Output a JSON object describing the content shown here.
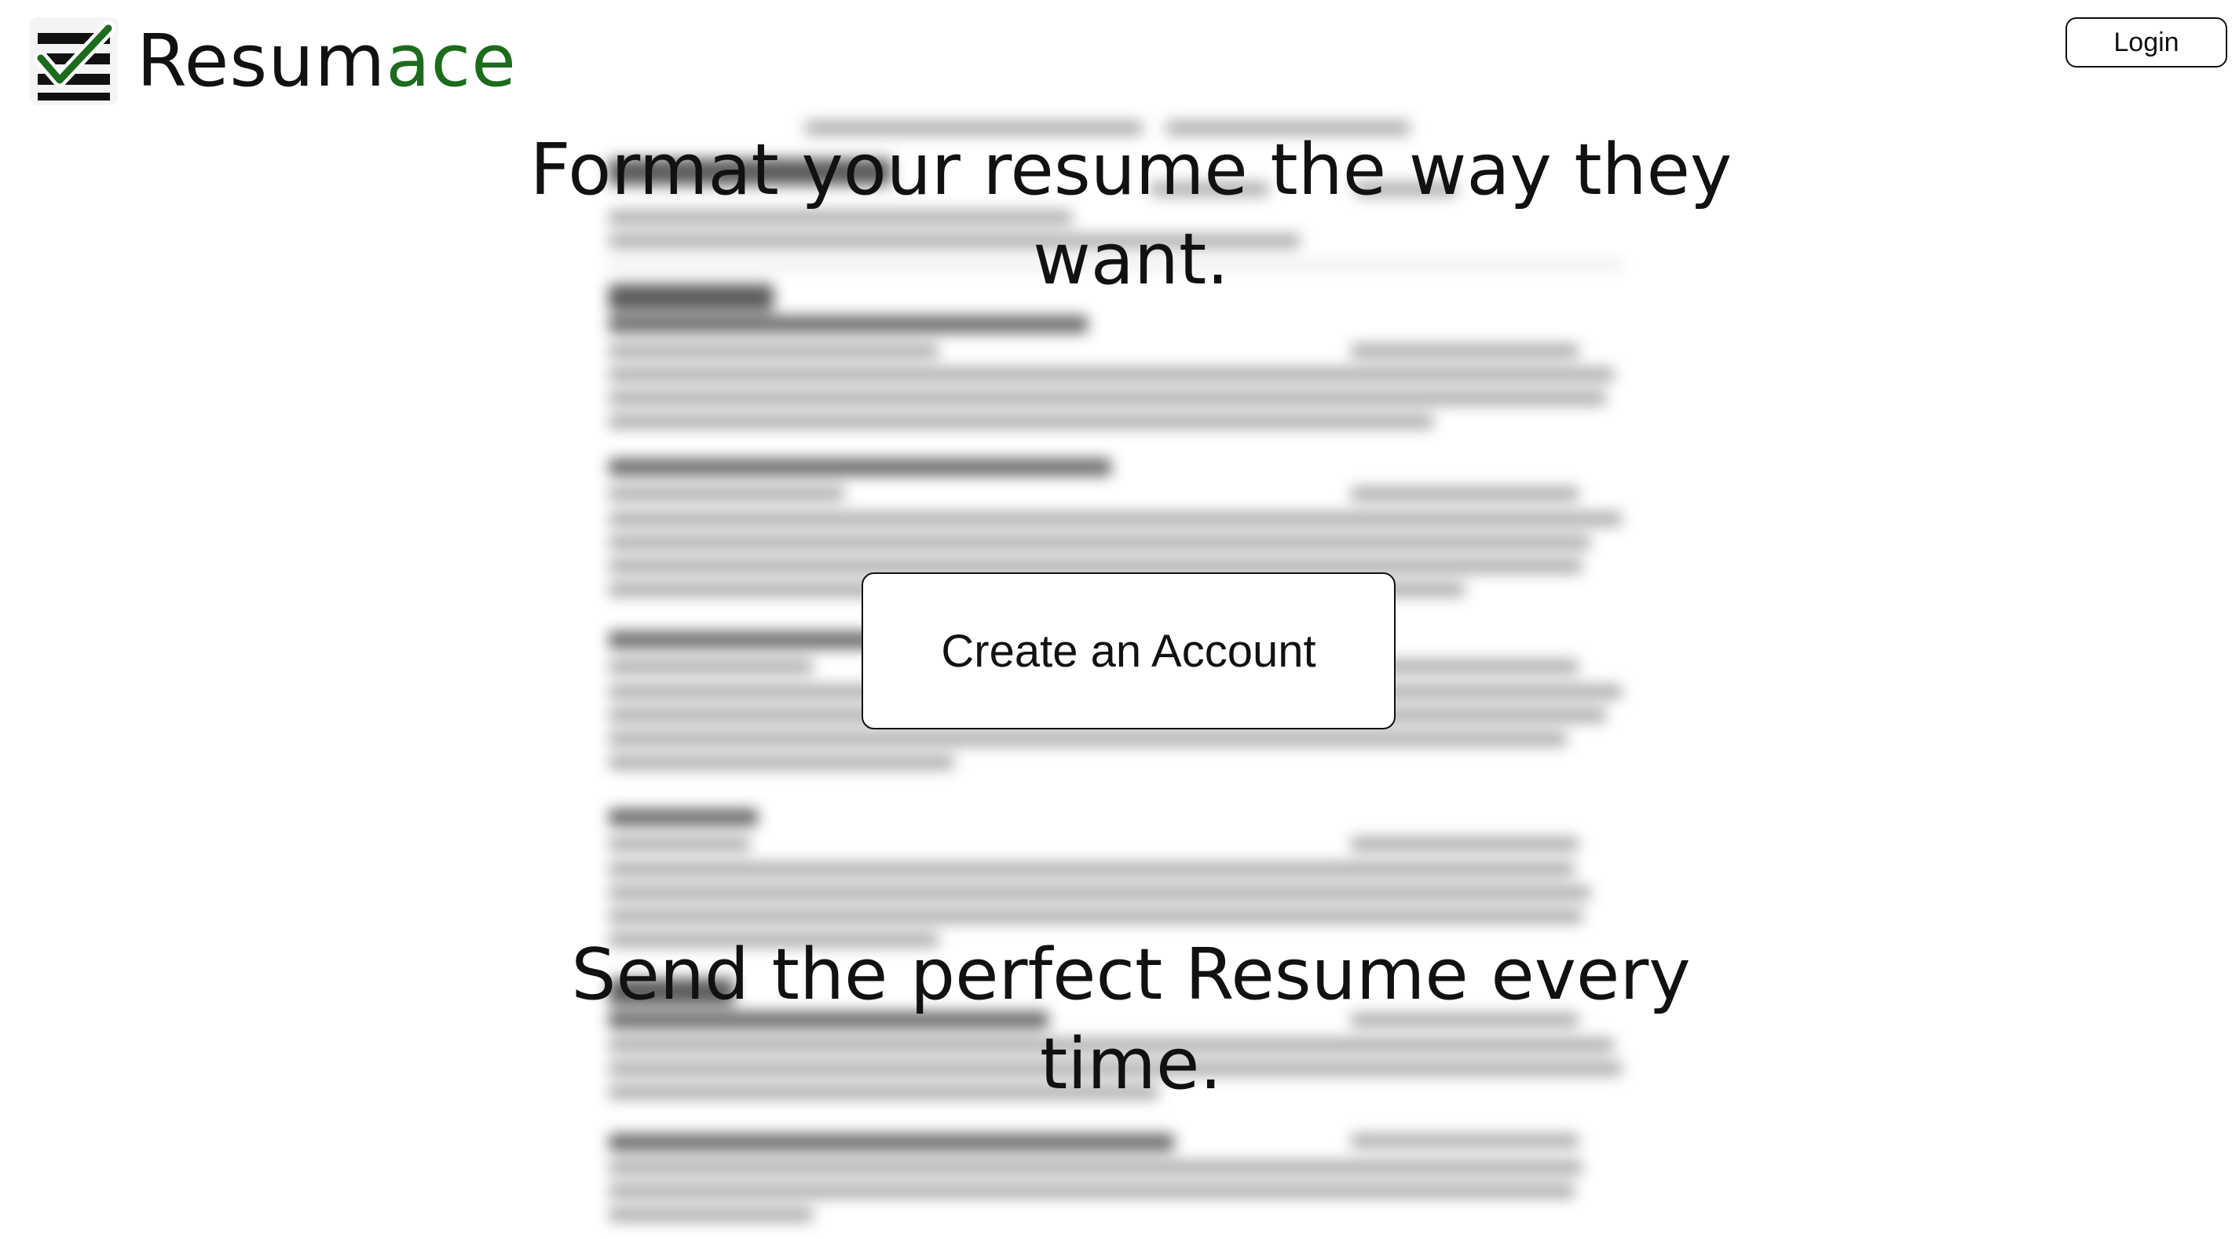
{
  "header": {
    "logo_text_main": "Resum",
    "logo_text_accent": "ace",
    "login_label": "Login"
  },
  "hero": {
    "headline_top": "Format your resume the way they want.",
    "cta_label": "Create an Account",
    "headline_bottom": "Send the perfect Resume every time."
  },
  "colors": {
    "accent": "#1d6b1d",
    "text": "#111111",
    "background": "#ffffff"
  },
  "icons": {
    "logo": "checklist-icon"
  }
}
